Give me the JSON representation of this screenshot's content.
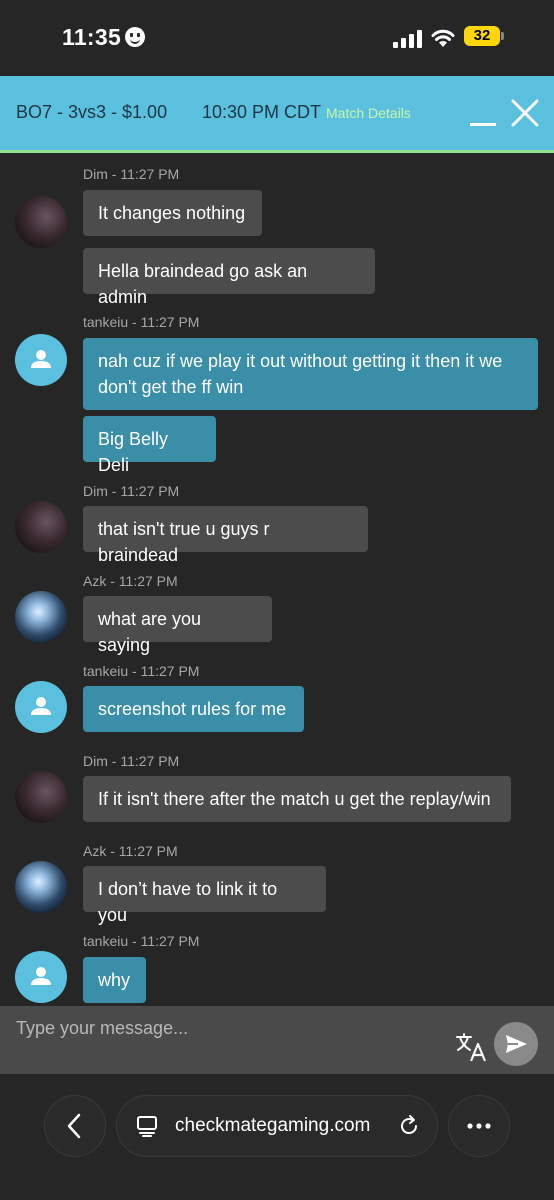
{
  "status_bar": {
    "time": "11:35",
    "battery": "32"
  },
  "header": {
    "title": "BO7 - 3vs3 - $1.00",
    "time": "10:30 PM CDT",
    "details_link": "Match Details"
  },
  "messages": [
    {
      "sender": "Dim - 11:27 PM",
      "avatar": "photo",
      "texts": [
        "It changes nothing",
        "Hella braindead go ask an admin"
      ]
    },
    {
      "sender": "tankeiu - 11:27 PM",
      "avatar": "default-user",
      "texts": [
        "nah cuz if we play it out without getting it then it we don't get the ff win",
        "Big Belly Deli"
      ]
    },
    {
      "sender": "Dim - 11:27 PM",
      "avatar": "photo",
      "texts": [
        "that isn't true u guys r braindead"
      ]
    },
    {
      "sender": "Azk - 11:27 PM",
      "avatar": "photo",
      "texts": [
        "what are you saying"
      ]
    },
    {
      "sender": "tankeiu - 11:27 PM",
      "avatar": "default-user",
      "texts": [
        "screenshot rules for me"
      ]
    },
    {
      "sender": "Dim - 11:27 PM",
      "avatar": "photo",
      "texts": [
        "If it isn't there after the match u get the replay/win"
      ]
    },
    {
      "sender": "Azk - 11:27 PM",
      "avatar": "photo",
      "texts": [
        "I don’t have to link it to you"
      ]
    },
    {
      "sender": "tankeiu - 11:27 PM",
      "avatar": "default-user",
      "texts": [
        "why"
      ]
    }
  ],
  "composer": {
    "placeholder": "Type your message..."
  },
  "browser": {
    "url": "checkmategaming.com"
  },
  "colors": {
    "accent": "#5bc0de",
    "self_bubble": "#3a8ea8",
    "other_bubble": "#4c4c4c",
    "link_green": "#8ee28c"
  },
  "icons": [
    "emoji-face-icon",
    "cellular-signal-icon",
    "wifi-icon",
    "battery-icon",
    "minimize-icon",
    "close-icon",
    "user-icon",
    "translate-icon",
    "send-icon",
    "back-icon",
    "tabs-icon",
    "reload-icon",
    "more-icon"
  ]
}
